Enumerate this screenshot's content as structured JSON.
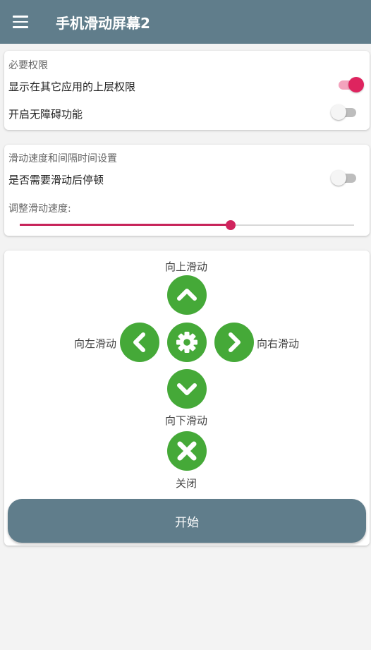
{
  "app": {
    "title": "手机滑动屏幕2",
    "menu_icon": "hamburger-menu-icon"
  },
  "permissions": {
    "section_title": "必要权限",
    "overlay": {
      "label": "显示在其它应用的上层权限",
      "enabled": true
    },
    "accessibility": {
      "label": "开启无障碍功能",
      "enabled": false
    }
  },
  "speed": {
    "section_title": "滑动速度和间隔时间设置",
    "pause": {
      "label": "是否需要滑动后停顿",
      "enabled": false
    },
    "speed_label": "调整滑动速度:",
    "speed_value": 0.63
  },
  "controls": {
    "up_label": "向上滑动",
    "left_label": "向左滑动",
    "right_label": "向右滑动",
    "down_label": "向下滑动",
    "close_label": "关闭",
    "start_label": "开始"
  },
  "colors": {
    "appbar": "#607d8b",
    "accent": "#de245f",
    "button_green": "#45a938"
  }
}
